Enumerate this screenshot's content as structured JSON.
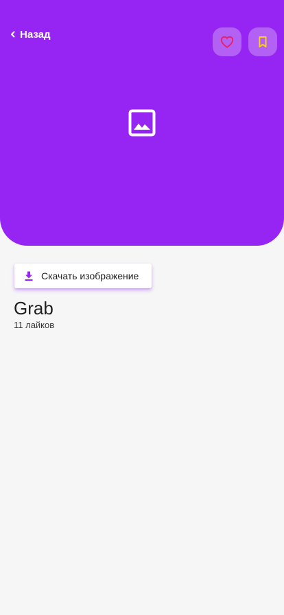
{
  "header": {
    "back_label": "Назад"
  },
  "colors": {
    "accent": "#9624f2",
    "like_icon": "#e91e63",
    "bookmark_icon": "#ffd600",
    "background": "#f6f6f6"
  },
  "icons": {
    "back": "chevron-left-icon",
    "like": "heart-outline-icon",
    "bookmark": "bookmark-outline-icon",
    "placeholder": "image-icon",
    "download": "download-icon"
  },
  "actions": {
    "download_label": "Скачать изображение"
  },
  "item": {
    "title": "Grab",
    "likes_text": "11 лайков"
  }
}
